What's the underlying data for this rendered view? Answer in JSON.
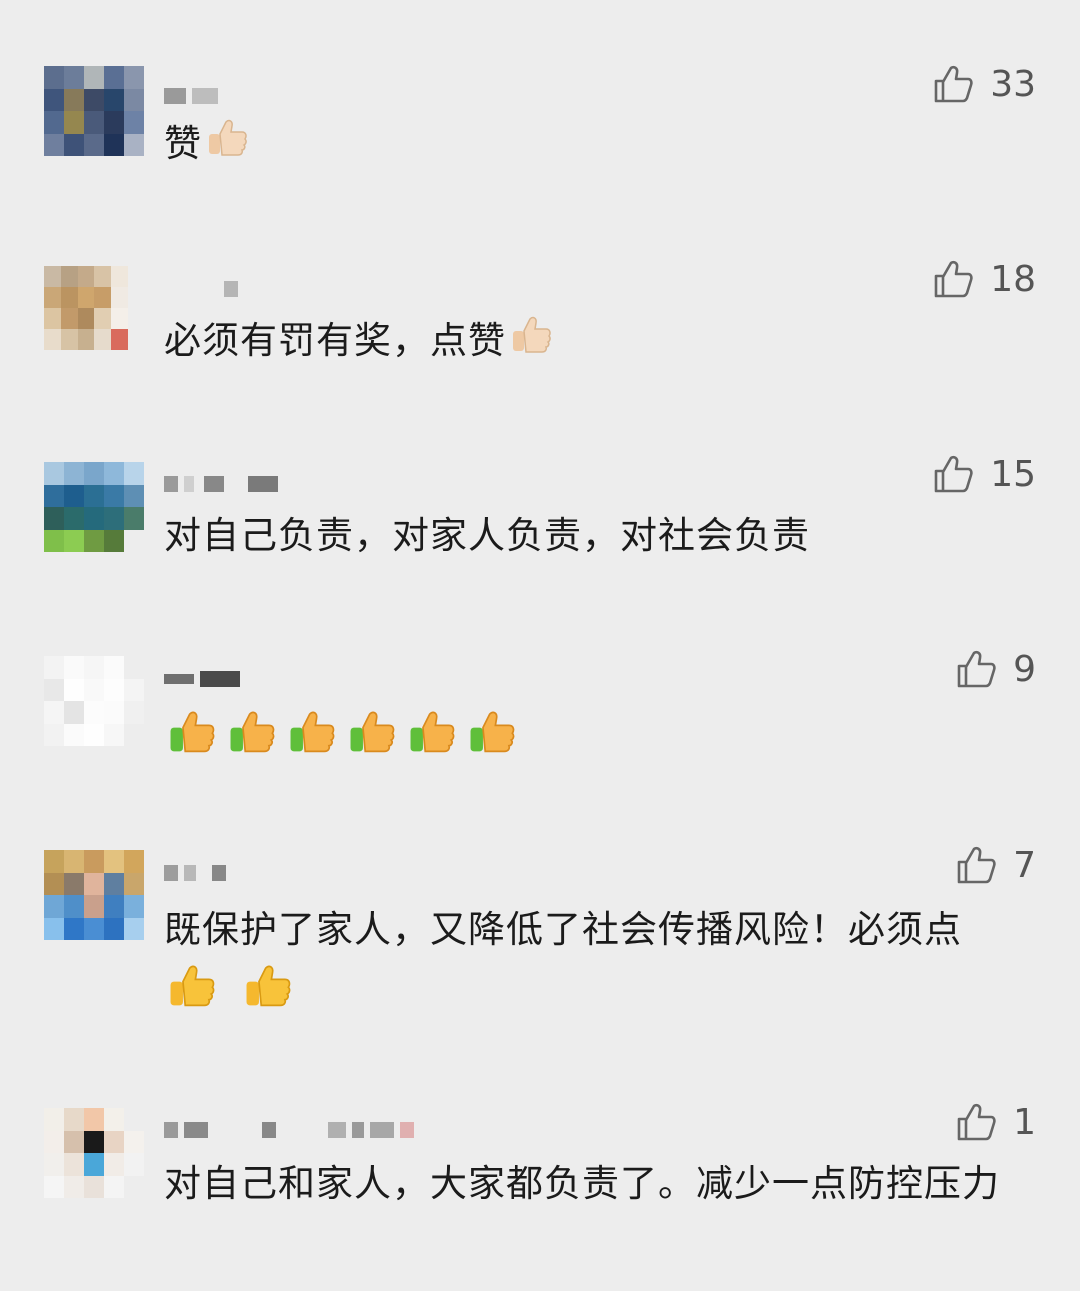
{
  "comments": [
    {
      "text": "赞",
      "likes": "33",
      "thumbs": 1,
      "thumb_style": "light"
    },
    {
      "text": "必须有罚有奖，点赞",
      "likes": "18",
      "thumbs": 1,
      "thumb_style": "light"
    },
    {
      "text": "对自己负责，对家人负责，对社会负责",
      "likes": "15",
      "thumbs": 0
    },
    {
      "text": "",
      "likes": "9",
      "thumbs": 6,
      "thumb_style": "green"
    },
    {
      "text": "既保护了家人，又降低了社会传播风险！必须点",
      "likes": "7",
      "thumbs": 2,
      "thumb_style": "yellow"
    },
    {
      "text": "对自己和家人，大家都负责了。减少一点防控压力",
      "likes": "1",
      "thumbs": 0
    }
  ],
  "icons": {
    "like": "thumbs-up-outline-icon",
    "avatar": "pixelated-avatar",
    "emoji": "thumbs-up-emoji-icon"
  },
  "colors": {
    "background": "#ededed",
    "text": "#1b1b1b",
    "like": "#555555"
  }
}
